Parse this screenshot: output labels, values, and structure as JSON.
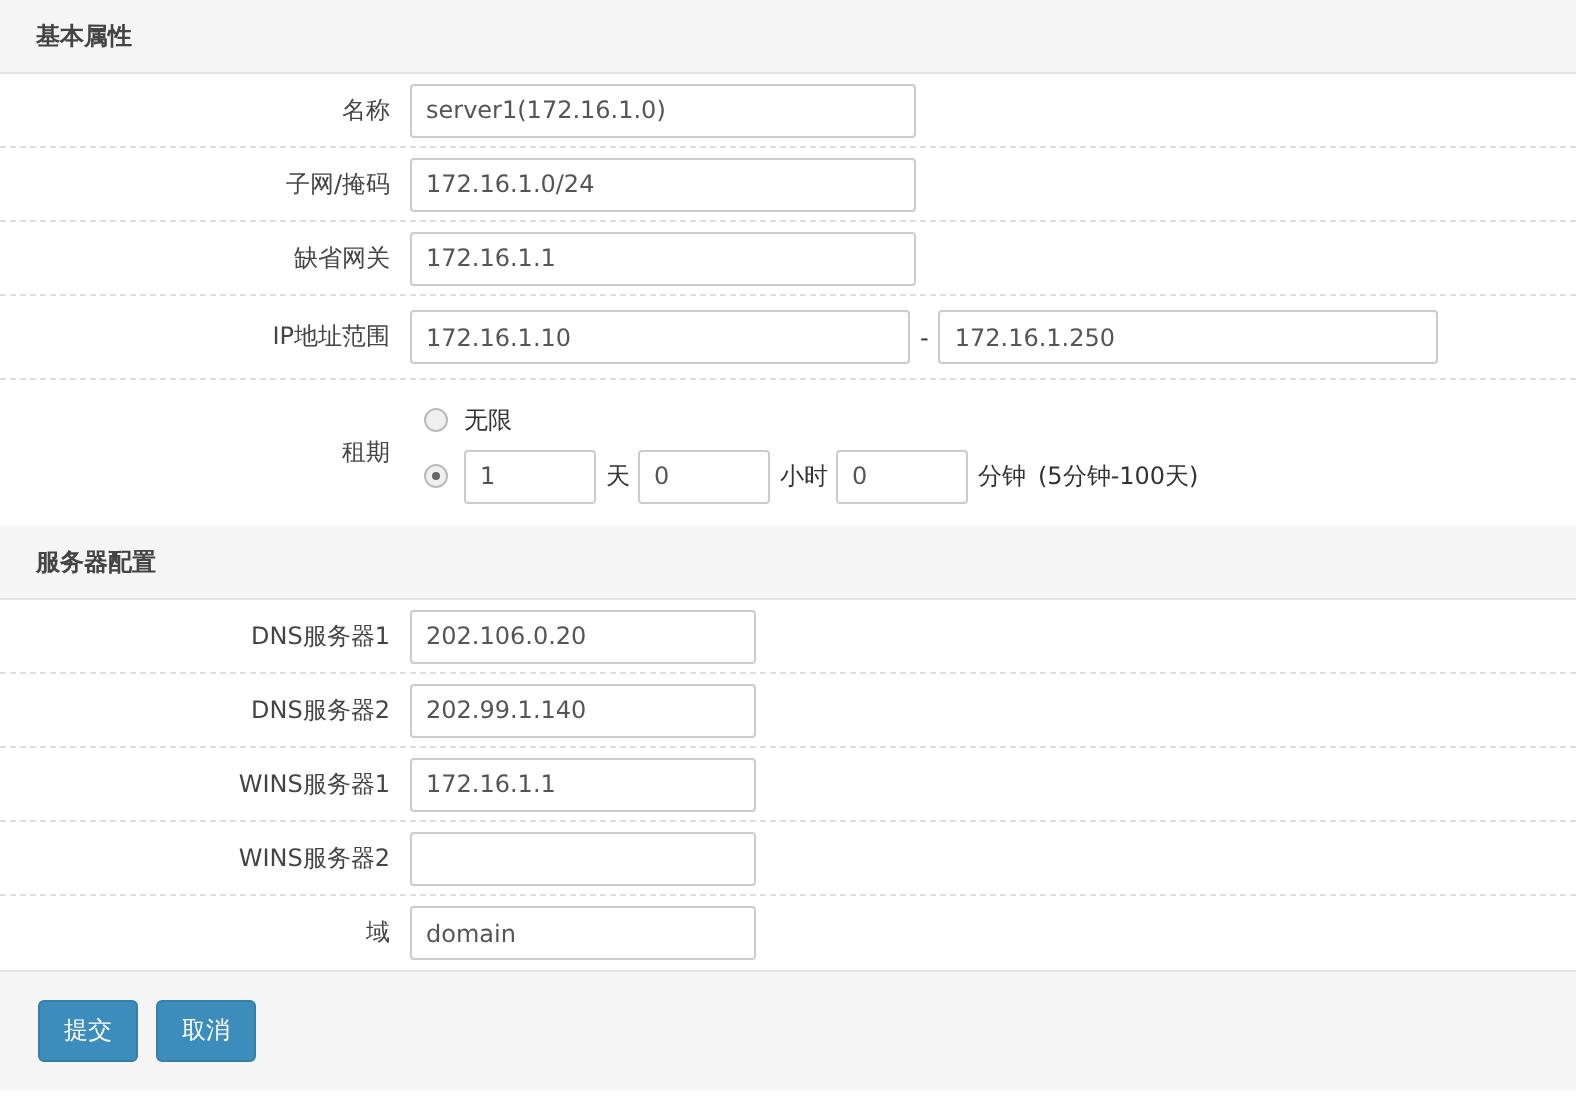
{
  "sections": [
    {
      "title": "基本属性",
      "fields": [
        {
          "kind": "text",
          "label": "名称",
          "value": "server1(172.16.1.0)"
        },
        {
          "kind": "text",
          "label": "子网/掩码",
          "value": "172.16.1.0/24"
        },
        {
          "kind": "text",
          "label": "缺省网关",
          "value": "172.16.1.1"
        },
        {
          "kind": "range",
          "label": "IP地址范围",
          "from": "172.16.1.10",
          "separator": "-",
          "to": "172.16.1.250"
        },
        {
          "kind": "lease",
          "label": "租期",
          "options": [
            {
              "label": "无限",
              "selected": false
            },
            {
              "selected": true,
              "parts": [
                {
                  "value": "1",
                  "unit": "天"
                },
                {
                  "value": "0",
                  "unit": "小时"
                },
                {
                  "value": "0",
                  "unit": "分钟"
                }
              ],
              "note": "(5分钟-100天)"
            }
          ]
        }
      ]
    },
    {
      "title": "服务器配置",
      "fields": [
        {
          "kind": "text",
          "label": "DNS服务器1",
          "value": "202.106.0.20"
        },
        {
          "kind": "text",
          "label": "DNS服务器2",
          "value": "202.99.1.140"
        },
        {
          "kind": "text",
          "label": "WINS服务器1",
          "value": "172.16.1.1"
        },
        {
          "kind": "text",
          "label": "WINS服务器2"
        },
        {
          "kind": "text",
          "label": "域",
          "value": "domain"
        }
      ]
    }
  ],
  "buttons": [
    "提交",
    "取消"
  ]
}
